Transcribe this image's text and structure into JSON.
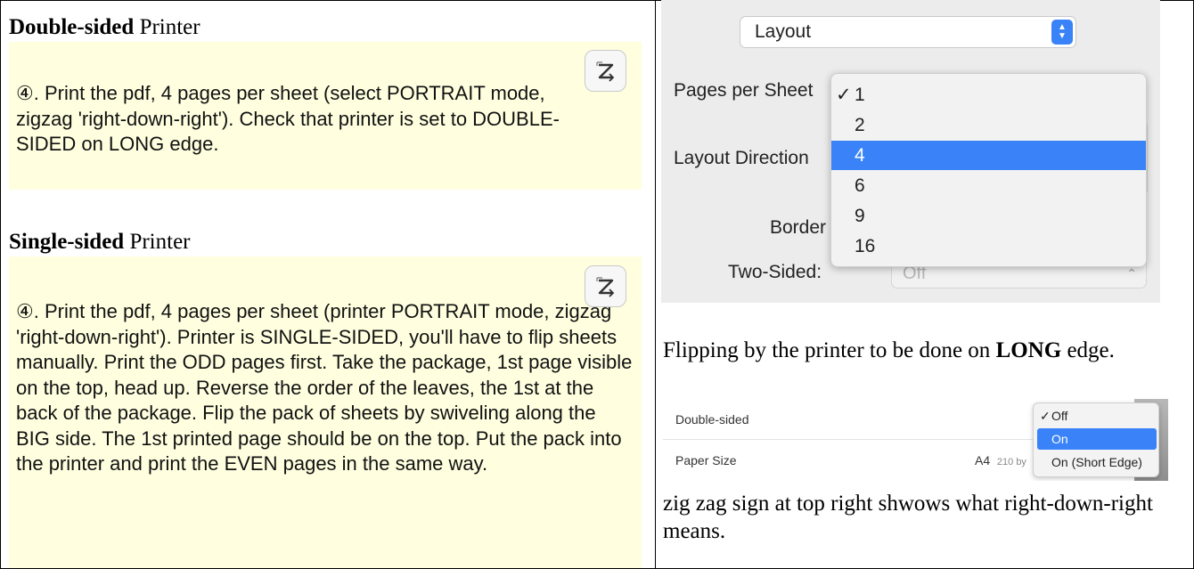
{
  "left": {
    "double": {
      "heading_bold": "Double-sided",
      "heading_rest": " Printer",
      "text": "④. Print the pdf, 4 pages per sheet (select PORTRAIT mode, zigzag 'right-down-right'). Check that printer is set to DOUBLE-SIDED on LONG edge."
    },
    "single": {
      "heading_bold": "Single-sided",
      "heading_rest": " Printer",
      "text": "④. Print the pdf, 4 pages per sheet (printer PORTRAIT mode, zigzag 'right-down-right'). Printer is SINGLE-SIDED, you'll have to flip sheets manually. Print the ODD pages first. Take the package, 1st page visible on the top, head up. Reverse the order of the leaves, the 1st at the back of the package. Flip the pack of sheets by swiveling along the BIG side. The 1st printed page should be on the top. Put the pack into the printer and print the EVEN pages in the same way."
    },
    "zigzag_icon": "zigzag-icon"
  },
  "print_dialog": {
    "layout_select": "Layout",
    "pages_per_sheet_label": "Pages per Sheet",
    "layout_direction_label": "Layout Direction",
    "border_label": "Border",
    "two_sided_label": "Two-Sided:",
    "two_sided_value": "Off",
    "pages_options": [
      "1",
      "2",
      "4",
      "6",
      "9",
      "16"
    ],
    "checked_option": "1",
    "highlighted_option": "4",
    "check_mark": "✓"
  },
  "right_text": {
    "flip_before": "Flipping by the printer to be done on ",
    "flip_bold": "LONG",
    "flip_after": " edge.",
    "zigzag_note": "zig zag sign at top right shwows what right-down-right means."
  },
  "mini_dialog": {
    "double_sided_label": "Double-sided",
    "paper_size_label": "Paper Size",
    "paper_size_value": "A4",
    "paper_size_dim": "210 by",
    "options": [
      "Off",
      "On",
      "On (Short Edge)"
    ],
    "checked_option": "Off",
    "highlighted_option": "On",
    "check_mark": "✓"
  },
  "colors": {
    "note_bg": "#ffffe0",
    "accent_blue": "#3a82f7",
    "dialog_bg": "#ececec"
  }
}
